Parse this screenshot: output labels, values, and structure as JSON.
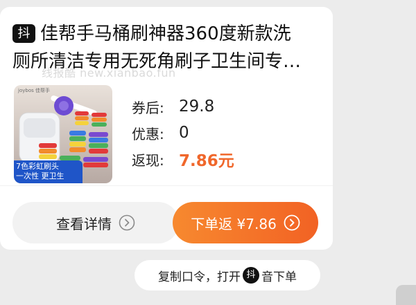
{
  "card": {
    "platform_badge": "抖",
    "title_line1": "佳帮手马桶刷神器360度新款洗",
    "title_line2": "厕所清洁专用无死角刷子卫生间专…",
    "watermark": "线报酷 new.xianbao.fun",
    "image_caption_line1": "7色彩虹刷头",
    "image_caption_line2": "一次性 更卫生",
    "coupon_label": "券后:",
    "coupon_value": "29.8",
    "discount_label": "优惠:",
    "discount_value": "0",
    "cashback_label": "返现:",
    "cashback_value": "7.86元"
  },
  "buttons": {
    "detail_label": "查看详情",
    "buy_label": "下单返 ¥7.86"
  },
  "tip": {
    "text_before": "复制口令，打开",
    "badge": "抖",
    "text_after": "音下单"
  },
  "colors": {
    "accent": "#f0672b",
    "buy_button_start": "#f7892f",
    "buy_button_end": "#f26224",
    "page_background": "#ececec"
  }
}
